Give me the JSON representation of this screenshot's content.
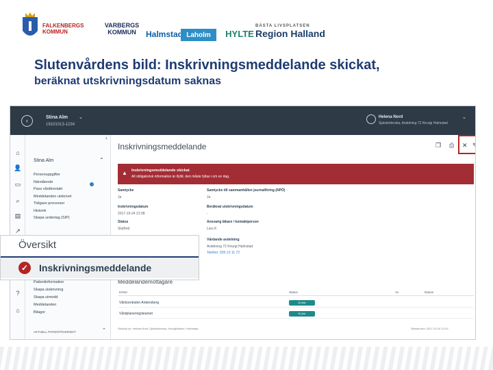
{
  "slide": {
    "title": "Slutenvårdens bild: Inskrivningsmeddelande skickat,",
    "subtitle": "beräknat utskrivningsdatum saknas"
  },
  "logos": {
    "falkenberg": "FALKENBERGS KOMMUN",
    "varberg_line1": "VARBERGS",
    "varberg_line2": "KOMMUN",
    "halmstad": "Halmstad",
    "laholm": "Laholm",
    "hylte": "HYLTE",
    "region_small": "BÄSTA LIVSPLATSEN",
    "region": "Region Halland"
  },
  "app": {
    "patient": {
      "name": "Stina Alm",
      "id": "19101013-1234"
    },
    "user": {
      "name": "Helena Nord",
      "unit": "Sjuksköterska, Avdelning 72 Kirurgi Halmstad"
    },
    "sidebar": {
      "name": "Stina Alm",
      "items": [
        "Personuppgifter",
        "Närstående",
        "Pass vårdkontakt",
        "Meddelanden utskrivet",
        "Tidigare processer",
        "Historik",
        "Skapa underlag (SIP)"
      ],
      "items2": [
        "Patientinformation",
        "Skapa utskrivning",
        "Skapa utmodd",
        "Meddelanden",
        "Bilagor"
      ],
      "footer": "AKTUELL PATIENTÖVERSIKT"
    },
    "main": {
      "title": "Inskrivningsmeddelande",
      "alert_title": "Inskrivningsmeddelande skickat",
      "alert_body": "All obligatorisk information är ifylld, den måste fyllas i om en dag.",
      "fields": {
        "samtycke_label": "Samtycke",
        "samtycke_value": "Ja",
        "journal_label": "Samtycke till sammanhållen journalföring (NPÖ)",
        "journal_value": "Ja",
        "inskr_label": "Inskrivningsdatum",
        "inskr_value": "2017-10-24 21:08",
        "utskr_label": "Beräknat utskrivningsdatum",
        "utskr_value": "-",
        "status_label": "Status",
        "status_value": "Slutförd",
        "ansvarig_label": "Ansvarig läkare / kontaktperson",
        "ansvarig_value": "Lars K",
        "enhet_label": "Vårdande avdelning",
        "enhet_value": "Avdelning 72 Kirurgi Halmstad",
        "telefon_value": "Telefon: 035-13 11 72"
      },
      "table_title": "Meddelandemottagare",
      "table_headers": [
        "Enhet",
        "Status",
        "Av",
        "Datum"
      ],
      "table_rows": [
        {
          "enhet": "Vårdcentralen Andersberg",
          "status": "Ej läst"
        },
        {
          "enhet": "Vårdplaneringsteamet",
          "status": "Ej läst"
        }
      ],
      "footer_left": "Skickad av: Helena Nord, Sjuksköterska, Kirurgkliniken i Halmstad",
      "footer_right": "Skickat den: 2017-10-24 21:20"
    },
    "zoom": {
      "title": "Översikt",
      "label": "Inskrivningsmeddelande"
    }
  },
  "colors": {
    "accent": "#1f3b73",
    "alert": "#a32d35",
    "highlight": "#b32424",
    "teal": "#1f8a8a"
  }
}
